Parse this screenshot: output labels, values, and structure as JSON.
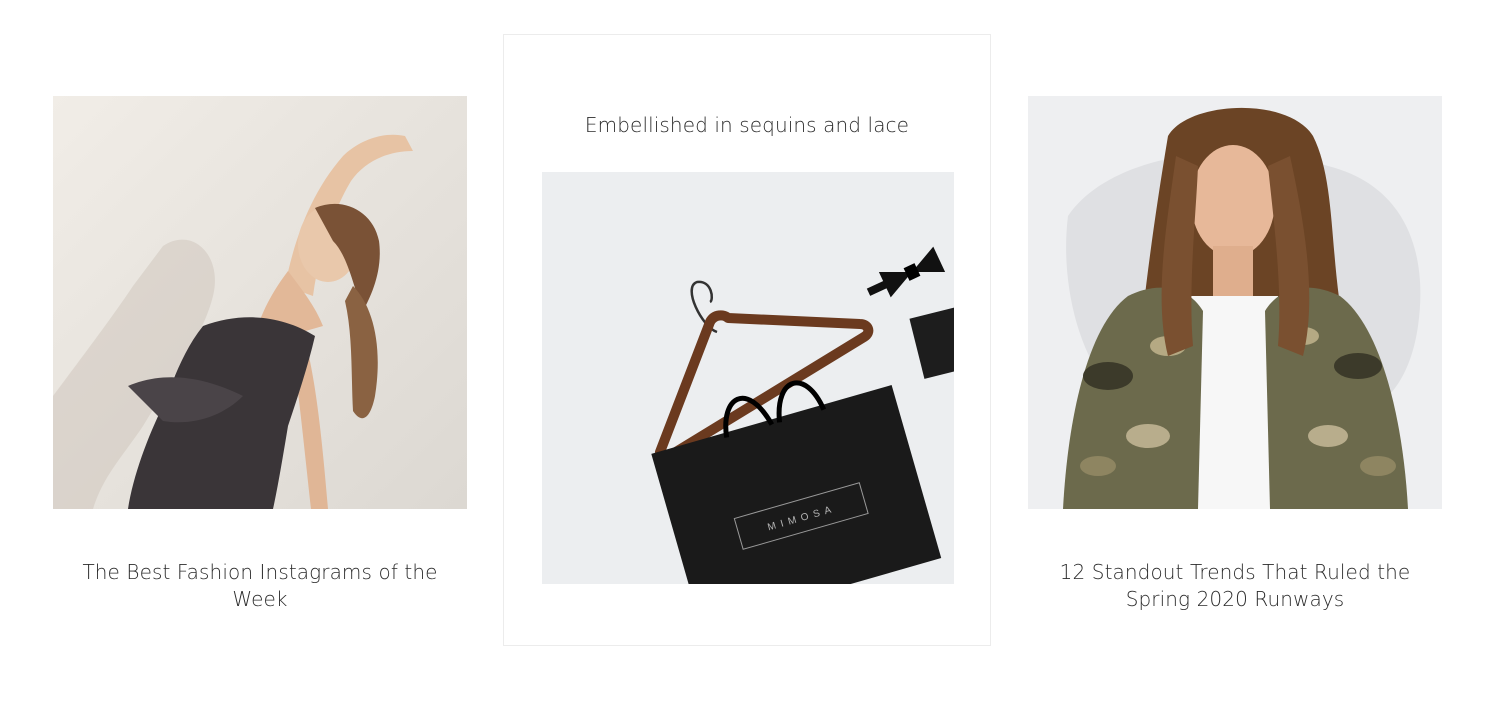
{
  "posts": [
    {
      "title": "The Best Fashion Instagrams of the Week",
      "image_alt": "Dancer in black strapless dress"
    },
    {
      "title": "Embellished in sequins and lace",
      "image_alt": "Black shopping bag with wooden hanger and bow tie",
      "bag_brand": "MIMOSA"
    },
    {
      "title": "12 Standout Trends That Ruled the Spring 2020 Runways",
      "image_alt": "Woman in camouflage bomber jacket"
    }
  ]
}
